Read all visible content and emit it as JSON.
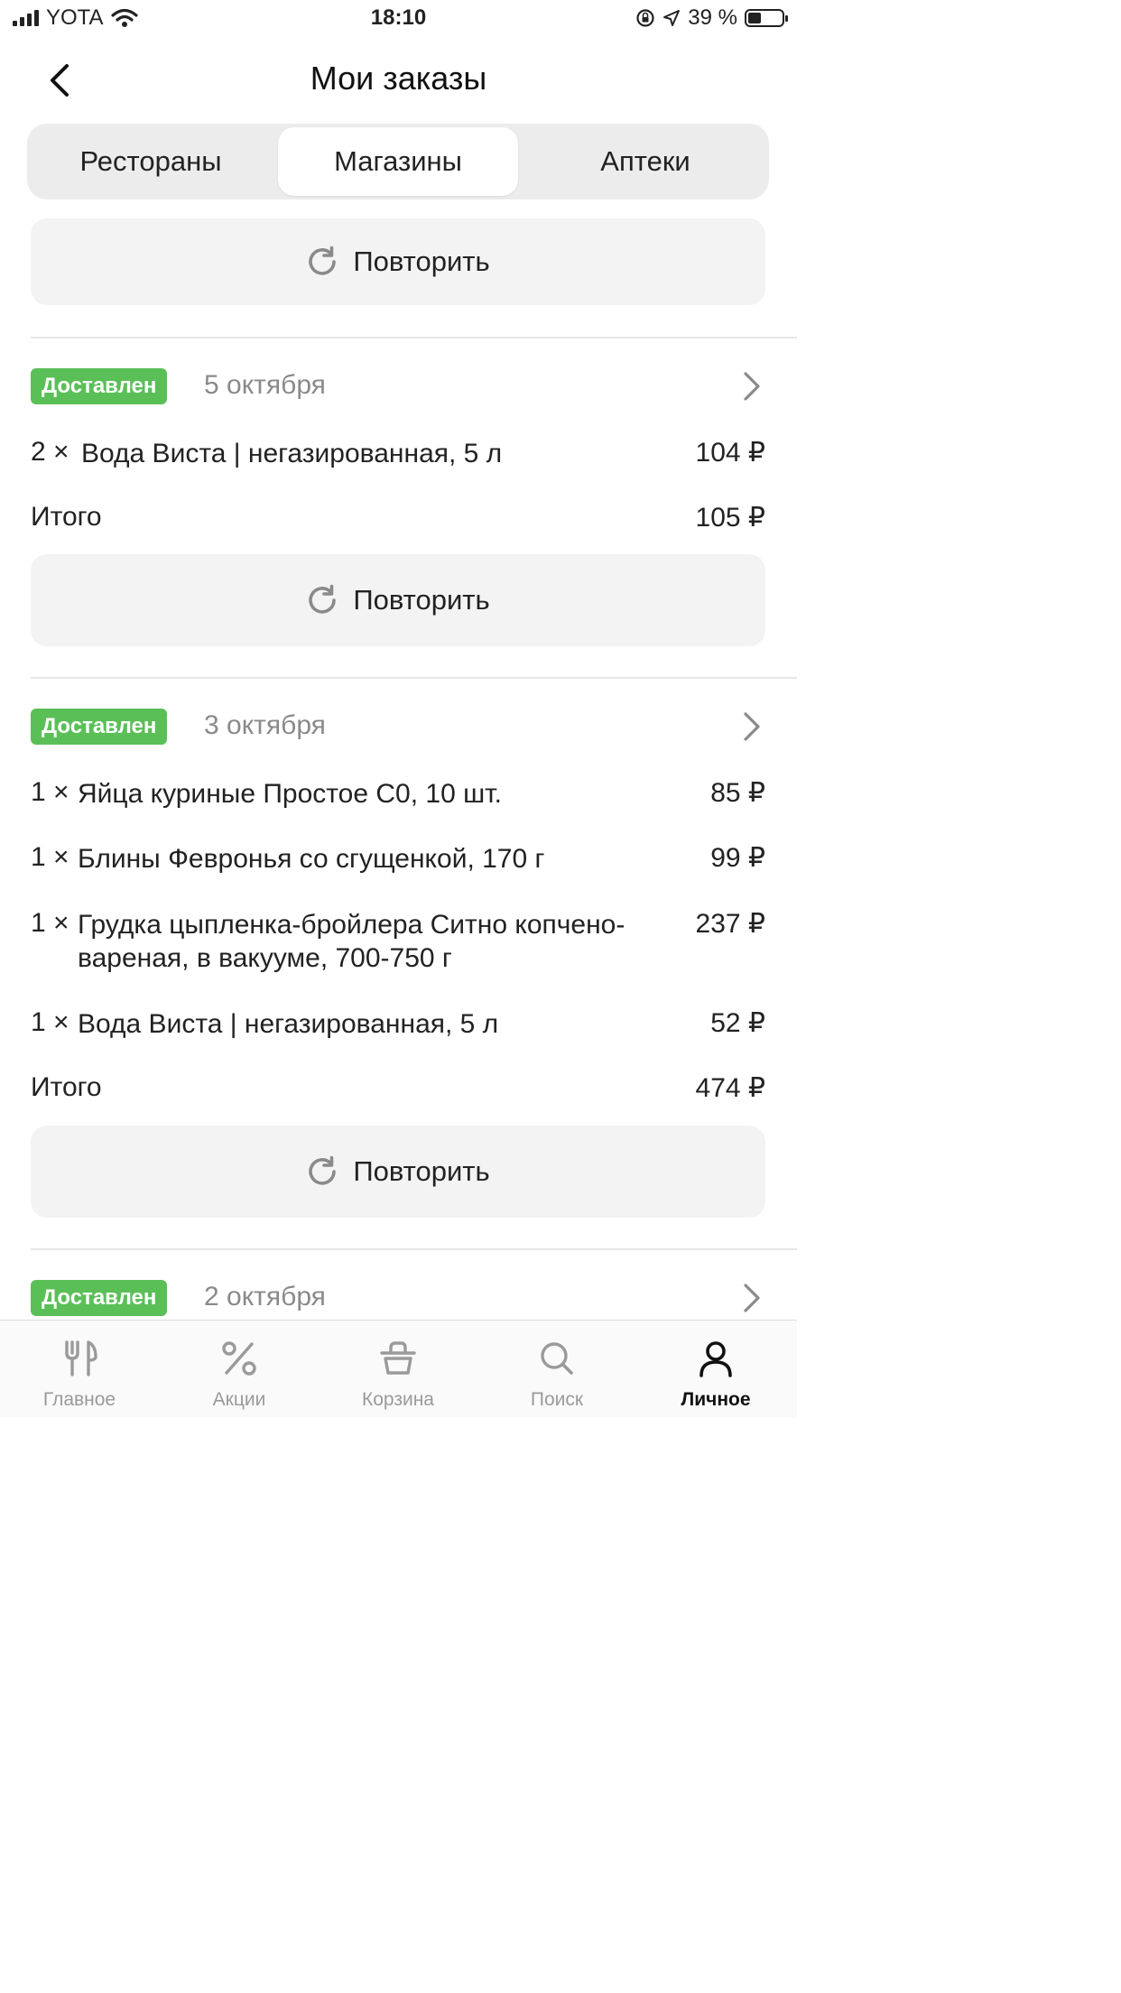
{
  "status_bar": {
    "carrier": "YOTA",
    "time": "18:10",
    "battery": "39 %",
    "battery_level": 0.39
  },
  "header": {
    "title": "Мои заказы",
    "back_icon": "chevron-left-icon"
  },
  "segments": [
    "Рестораны",
    "Магазины",
    "Аптеки"
  ],
  "active_segment": 1,
  "repeat_label": "Повторить",
  "orders": [
    {
      "status": "Доставлен",
      "date": "5 октября",
      "items": [
        {
          "qty": "2 ×",
          "name": "Вода Виста | негазированная, 5 л",
          "price": "104 ₽"
        }
      ],
      "total_label": "Итого",
      "total": "105 ₽"
    },
    {
      "status": "Доставлен",
      "date": "3 октября",
      "items": [
        {
          "qty": "1 ×",
          "name": "Яйца куриные Простое С0, 10 шт.",
          "price": "85 ₽"
        },
        {
          "qty": "1 ×",
          "name": "Блины Февронья со сгущенкой, 170 г",
          "price": "99 ₽"
        },
        {
          "qty": "1 ×",
          "name": "Грудка цыпленка-бройлера Ситно копчено-вареная, в вакууме, 700-750 г",
          "price": "237 ₽"
        },
        {
          "qty": "1 ×",
          "name": "Вода Виста | негазированная, 5 л",
          "price": "52 ₽"
        }
      ],
      "total_label": "Итого",
      "total": "474 ₽"
    },
    {
      "status": "Доставлен",
      "date": "2 октября"
    }
  ],
  "tabbar": [
    {
      "label": "Главное",
      "icon": "fork-knife-icon"
    },
    {
      "label": "Акции",
      "icon": "percent-icon"
    },
    {
      "label": "Корзина",
      "icon": "basket-icon"
    },
    {
      "label": "Поиск",
      "icon": "search-icon"
    },
    {
      "label": "Личное",
      "icon": "profile-icon"
    }
  ],
  "active_tab": 4,
  "colors": {
    "badge_green": "#5bbf58",
    "segment_bg": "#ececec",
    "button_bg": "#f3f3f3",
    "date_gray": "#8a8a8a"
  }
}
